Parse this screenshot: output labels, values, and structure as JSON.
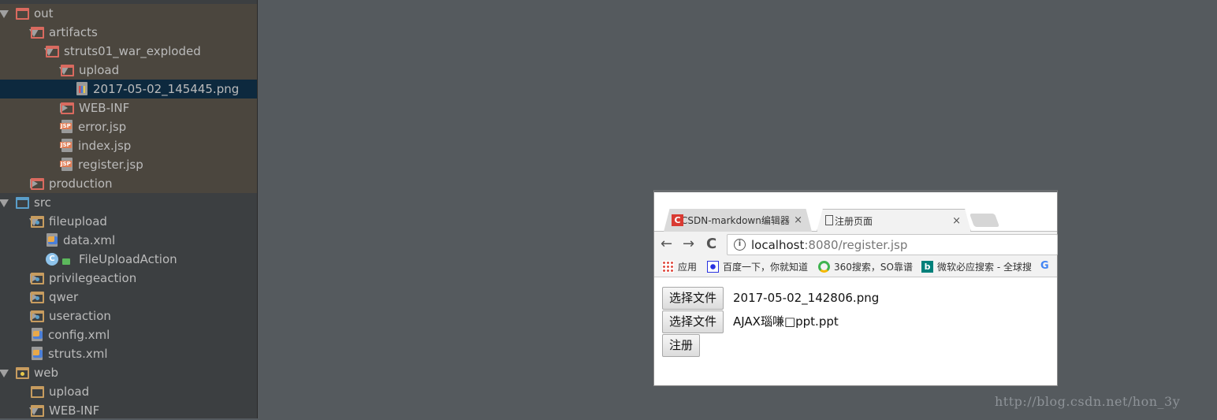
{
  "project_tree": [
    {
      "label": "out",
      "level": 0,
      "arrow": "open",
      "icon": "folder-excluded",
      "section": "out"
    },
    {
      "label": "artifacts",
      "level": 1,
      "arrow": "open",
      "icon": "folder-excluded",
      "section": "out"
    },
    {
      "label": "struts01_war_exploded",
      "level": 2,
      "arrow": "open",
      "icon": "folder-excluded",
      "section": "out"
    },
    {
      "label": "upload",
      "level": 3,
      "arrow": "open",
      "icon": "folder-excluded",
      "section": "out"
    },
    {
      "label": "2017-05-02_145445.png",
      "level": 4,
      "arrow": "none",
      "icon": "image-file",
      "section": "out",
      "selected": true
    },
    {
      "label": "WEB-INF",
      "level": 3,
      "arrow": "closed",
      "icon": "folder-excluded",
      "section": "out"
    },
    {
      "label": "error.jsp",
      "level": 3,
      "arrow": "none",
      "icon": "jsp-file",
      "section": "out"
    },
    {
      "label": "index.jsp",
      "level": 3,
      "arrow": "none",
      "icon": "jsp-file",
      "section": "out"
    },
    {
      "label": "register.jsp",
      "level": 3,
      "arrow": "none",
      "icon": "jsp-file",
      "section": "out"
    },
    {
      "label": "production",
      "level": 1,
      "arrow": "closed",
      "icon": "folder-excluded",
      "section": "out"
    },
    {
      "label": "src",
      "level": 0,
      "arrow": "open",
      "icon": "folder-source",
      "section": "src"
    },
    {
      "label": "fileupload",
      "level": 1,
      "arrow": "open",
      "icon": "package",
      "section": "src"
    },
    {
      "label": "data.xml",
      "level": 2,
      "arrow": "none",
      "icon": "xml-file",
      "section": "src"
    },
    {
      "label": "FileUploadAction",
      "level": 2,
      "arrow": "none",
      "icon": "class",
      "section": "src"
    },
    {
      "label": "privilegeaction",
      "level": 1,
      "arrow": "closed",
      "icon": "package",
      "section": "src"
    },
    {
      "label": "qwer",
      "level": 1,
      "arrow": "closed",
      "icon": "package",
      "section": "src"
    },
    {
      "label": "useraction",
      "level": 1,
      "arrow": "closed",
      "icon": "package",
      "section": "src"
    },
    {
      "label": "config.xml",
      "level": 1,
      "arrow": "none",
      "icon": "xml-file",
      "section": "src"
    },
    {
      "label": "struts.xml",
      "level": 1,
      "arrow": "none",
      "icon": "xml-file",
      "section": "src"
    },
    {
      "label": "web",
      "level": 0,
      "arrow": "open",
      "icon": "folder-web",
      "section": "web"
    },
    {
      "label": "upload",
      "level": 1,
      "arrow": "none",
      "icon": "folder",
      "section": "web"
    },
    {
      "label": "WEB-INF",
      "level": 1,
      "arrow": "open",
      "icon": "folder",
      "section": "web"
    }
  ],
  "browser": {
    "tabs": [
      {
        "title": "CSDN-markdown编辑器",
        "active": false,
        "close": "×"
      },
      {
        "title": "注册页面",
        "active": true,
        "close": "×"
      }
    ],
    "nav": {
      "back": "←",
      "forward": "→",
      "reload": "C"
    },
    "url": {
      "host": "localhost",
      "rest": ":8080/register.jsp"
    },
    "bookmarks": [
      {
        "label": "应用",
        "icon": "apps-grid-icon"
      },
      {
        "label": "百度一下，你就知道",
        "icon": "baidu-paw-icon"
      },
      {
        "label": "360搜索，SO靠谱",
        "icon": "360-search-icon"
      },
      {
        "label": "微软必应搜索 - 全球搜",
        "icon": "bing-icon"
      },
      {
        "label": "",
        "icon": "google-icon"
      }
    ],
    "form": {
      "choose_file_label": "选择文件",
      "file1": "2017-05-02_142806.png",
      "file2": "AJAX瑙嗛□ppt.ppt",
      "submit_label": "注册"
    }
  },
  "watermark": "http://blog.csdn.net/hon_3y"
}
